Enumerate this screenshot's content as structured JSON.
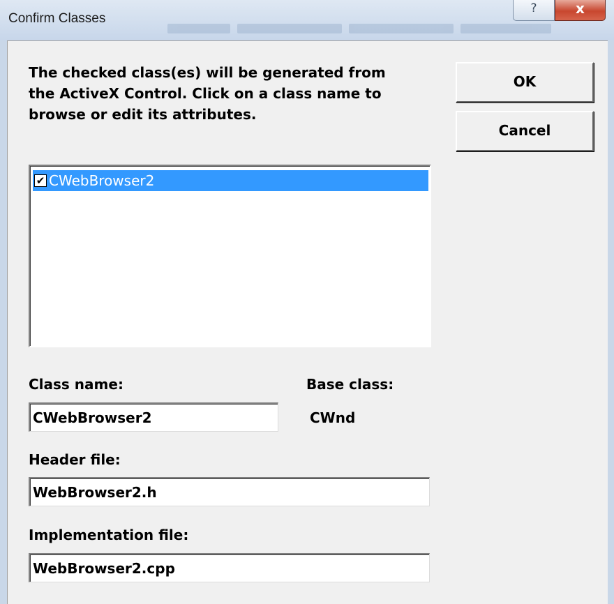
{
  "window": {
    "title": "Confirm Classes",
    "help_glyph": "?",
    "close_glyph": "x"
  },
  "prompt": "The checked class(es) will be generated from\nthe ActiveX Control.  Click on a class name to\nbrowse or edit its attributes.",
  "buttons": {
    "ok_label": "OK",
    "cancel_label": "Cancel"
  },
  "class_list": {
    "items": [
      {
        "label": "CWebBrowser2",
        "checked": true,
        "selected": true,
        "check_glyph": "✔"
      }
    ]
  },
  "fields": {
    "class_name_label": "Class name:",
    "class_name_value": "CWebBrowser2",
    "base_class_label": "Base class:",
    "base_class_value": "CWnd",
    "header_file_label": "Header file:",
    "header_file_value": "WebBrowser2.h",
    "implementation_file_label": "Implementation file:",
    "implementation_file_value": "WebBrowser2.cpp"
  },
  "colors": {
    "selection": "#3399ff",
    "face": "#f0f0f0",
    "close_button": "#c8472f"
  }
}
